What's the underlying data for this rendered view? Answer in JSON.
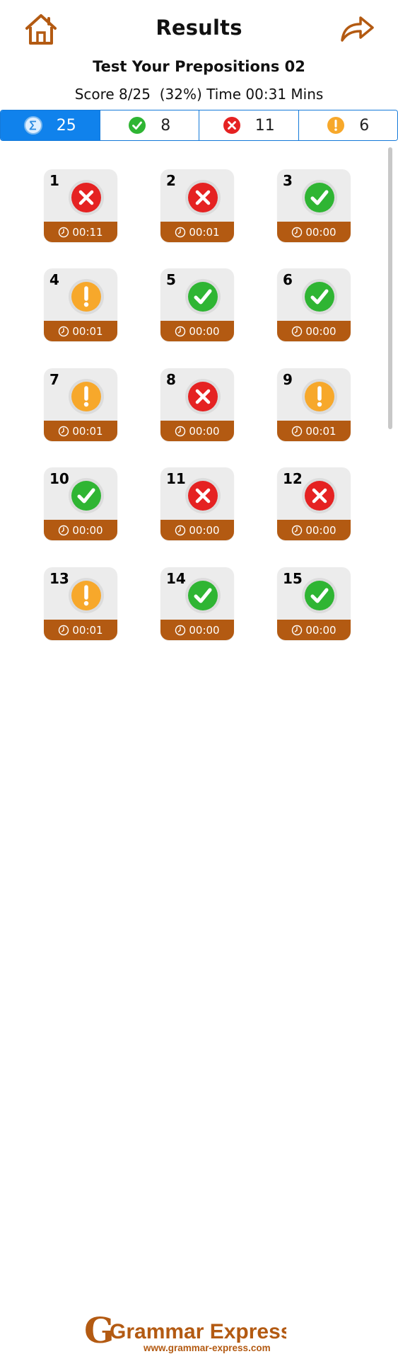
{
  "header": {
    "title": "Results",
    "home_icon": "home-icon",
    "share_icon": "share-arrow-icon",
    "accent": "#b35a12"
  },
  "test": {
    "name": "Test Your Prepositions 02",
    "score_line": "Score 8/25  (32%) Time 00:31 Mins"
  },
  "tabs": [
    {
      "icon": "sum-icon",
      "count": "25",
      "active": true
    },
    {
      "icon": "correct-icon",
      "count": "8",
      "active": false
    },
    {
      "icon": "wrong-icon",
      "count": "11",
      "active": false
    },
    {
      "icon": "skipped-icon",
      "count": "6",
      "active": false
    }
  ],
  "questions": [
    {
      "number": "1",
      "status": "wrong",
      "time": "00:11"
    },
    {
      "number": "2",
      "status": "wrong",
      "time": "00:01"
    },
    {
      "number": "3",
      "status": "correct",
      "time": "00:00"
    },
    {
      "number": "4",
      "status": "skipped",
      "time": "00:01"
    },
    {
      "number": "5",
      "status": "correct",
      "time": "00:00"
    },
    {
      "number": "6",
      "status": "correct",
      "time": "00:00"
    },
    {
      "number": "7",
      "status": "skipped",
      "time": "00:01"
    },
    {
      "number": "8",
      "status": "wrong",
      "time": "00:00"
    },
    {
      "number": "9",
      "status": "skipped",
      "time": "00:01"
    },
    {
      "number": "10",
      "status": "correct",
      "time": "00:00"
    },
    {
      "number": "11",
      "status": "wrong",
      "time": "00:00"
    },
    {
      "number": "12",
      "status": "wrong",
      "time": "00:00"
    },
    {
      "number": "13",
      "status": "skipped",
      "time": "00:01"
    },
    {
      "number": "14",
      "status": "correct",
      "time": "00:00"
    },
    {
      "number": "15",
      "status": "correct",
      "time": "00:00"
    }
  ],
  "footer": {
    "brand": "Grammar Express",
    "url": "www.grammar-express.com"
  },
  "colors": {
    "correct": "#2fb533",
    "wrong": "#e52222",
    "skipped": "#f7a82b",
    "sum": "#3a9ae8",
    "tab_active": "#1082ec",
    "card_bar": "#b35a12"
  }
}
